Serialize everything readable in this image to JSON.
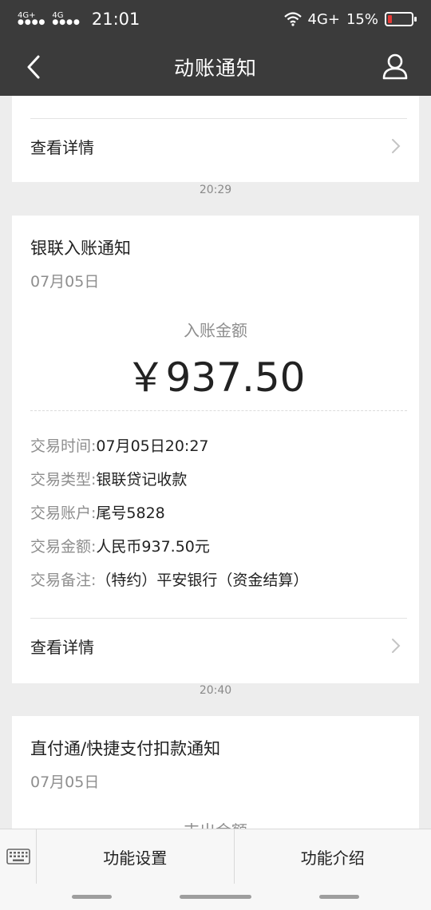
{
  "status_bar": {
    "signal_1": "4G+",
    "signal_2": "4G",
    "time": "21:01",
    "network": "4G+",
    "battery": "15%"
  },
  "nav": {
    "title": "动账通知"
  },
  "cards": [
    {
      "detail_label": "查看详情"
    },
    {
      "time": "20:29",
      "title": "银联入账通知",
      "date": "07月05日",
      "amount_label": "入账金额",
      "amount": "￥937.50",
      "fields": [
        {
          "key": "交易时间:",
          "value": "07月05日20:27"
        },
        {
          "key": "交易类型:",
          "value": "银联贷记收款"
        },
        {
          "key": "交易账户:",
          "value": "尾号5828"
        },
        {
          "key": "交易金额:",
          "value": "人民币937.50元"
        },
        {
          "key": "交易备注:",
          "value": "（特约）平安银行（资金结算）"
        }
      ],
      "detail_label": "查看详情"
    },
    {
      "time": "20:40",
      "title": "直付通/快捷支付扣款通知",
      "date": "07月05日",
      "amount_label": "支出金额"
    }
  ],
  "bottom_bar": {
    "tab1": "功能设置",
    "tab2": "功能介绍"
  },
  "colors": {
    "header_bg": "#3b3b3b",
    "page_bg": "#ededed",
    "battery_low": "#e53935"
  }
}
